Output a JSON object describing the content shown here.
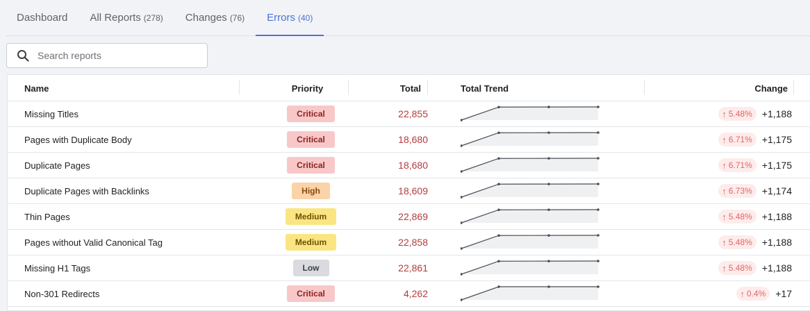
{
  "tabs": [
    {
      "label": "Dashboard",
      "count": ""
    },
    {
      "label": "All Reports",
      "count": "(278)"
    },
    {
      "label": "Changes",
      "count": "(76)"
    },
    {
      "label": "Errors",
      "count": "(40)"
    }
  ],
  "active_tab": "Errors",
  "search": {
    "placeholder": "Search reports",
    "value": ""
  },
  "columns": {
    "name": "Name",
    "priority": "Priority",
    "total": "Total",
    "trend": "Total Trend",
    "change": "Change"
  },
  "priority_colors": {
    "Critical": {
      "bg": "#f8c8c8",
      "fg": "#8b1f1f"
    },
    "High": {
      "bg": "#fad3a8",
      "fg": "#8a4b10"
    },
    "Medium": {
      "bg": "#fbe583",
      "fg": "#6b5300"
    },
    "Low": {
      "bg": "#d9dbe0",
      "fg": "#3c4043"
    }
  },
  "rows": [
    {
      "name": "Missing Titles",
      "priority": "Critical",
      "total": "22,855",
      "pct": "5.48%",
      "delta": "+1,188",
      "trend": [
        21667,
        22840,
        22848,
        22855
      ]
    },
    {
      "name": "Pages with Duplicate Body",
      "priority": "Critical",
      "total": "18,680",
      "pct": "6.71%",
      "delta": "+1,175",
      "trend": [
        17505,
        18665,
        18672,
        18680
      ]
    },
    {
      "name": "Duplicate Pages",
      "priority": "Critical",
      "total": "18,680",
      "pct": "6.71%",
      "delta": "+1,175",
      "trend": [
        17505,
        18665,
        18672,
        18680
      ]
    },
    {
      "name": "Duplicate Pages with Backlinks",
      "priority": "High",
      "total": "18,609",
      "pct": "6.73%",
      "delta": "+1,174",
      "trend": [
        17435,
        18595,
        18602,
        18609
      ]
    },
    {
      "name": "Thin Pages",
      "priority": "Medium",
      "total": "22,869",
      "pct": "5.48%",
      "delta": "+1,188",
      "trend": [
        21681,
        22854,
        22861,
        22869
      ]
    },
    {
      "name": "Pages without Valid Canonical Tag",
      "priority": "Medium",
      "total": "22,858",
      "pct": "5.48%",
      "delta": "+1,188",
      "trend": [
        21670,
        22843,
        22850,
        22858
      ]
    },
    {
      "name": "Missing H1 Tags",
      "priority": "Low",
      "total": "22,861",
      "pct": "5.48%",
      "delta": "+1,188",
      "trend": [
        21673,
        22846,
        22853,
        22861
      ]
    },
    {
      "name": "Non-301 Redirects",
      "priority": "Critical",
      "total": "4,262",
      "pct": "0.4%",
      "delta": "+17",
      "trend": [
        4245,
        4262,
        4262,
        4262
      ]
    }
  ]
}
